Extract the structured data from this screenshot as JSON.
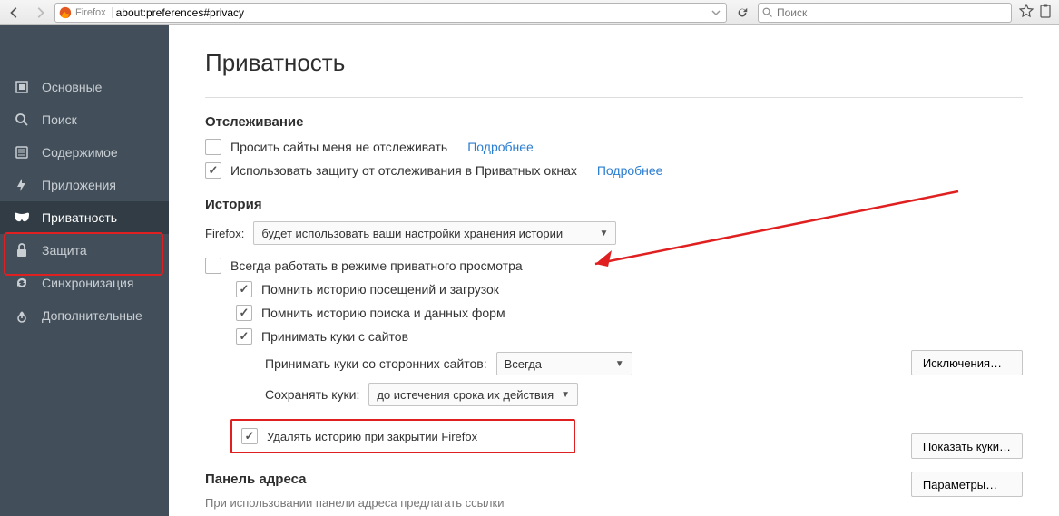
{
  "chrome": {
    "firefox_label": "Firefox",
    "url": "about:preferences#privacy",
    "search_placeholder": "Поиск"
  },
  "sidebar": {
    "items": [
      {
        "label": "Основные"
      },
      {
        "label": "Поиск"
      },
      {
        "label": "Содержимое"
      },
      {
        "label": "Приложения"
      },
      {
        "label": "Приватность"
      },
      {
        "label": "Защита"
      },
      {
        "label": "Синхронизация"
      },
      {
        "label": "Дополнительные"
      }
    ]
  },
  "page": {
    "title": "Приватность",
    "tracking": {
      "heading": "Отслеживание",
      "dnt_label": "Просить сайты меня не отслеживать",
      "dnt_more": "Подробнее",
      "tp_label": "Использовать защиту от отслеживания в Приватных окнах",
      "tp_more": "Подробнее"
    },
    "history": {
      "heading": "История",
      "mode_prefix": "Firefox:",
      "mode_value": "будет использовать ваши настройки хранения истории",
      "always_private": "Всегда работать в режиме приватного просмотра",
      "remember_browsing": "Помнить историю посещений и загрузок",
      "remember_search": "Помнить историю поиска и данных форм",
      "accept_cookies": "Принимать куки с сайтов",
      "third_party_label": "Принимать куки со сторонних сайтов:",
      "third_party_value": "Всегда",
      "keep_until_label": "Сохранять куки:",
      "keep_until_value": "до истечения срока их действия",
      "clear_on_close": "Удалять историю при закрытии Firefox",
      "btn_exceptions": "Исключения…",
      "btn_show_cookies": "Показать куки…",
      "btn_settings": "Параметры…"
    },
    "addressbar": {
      "heading": "Панель адреса",
      "sub": "При использовании панели адреса предлагать ссылки"
    }
  }
}
